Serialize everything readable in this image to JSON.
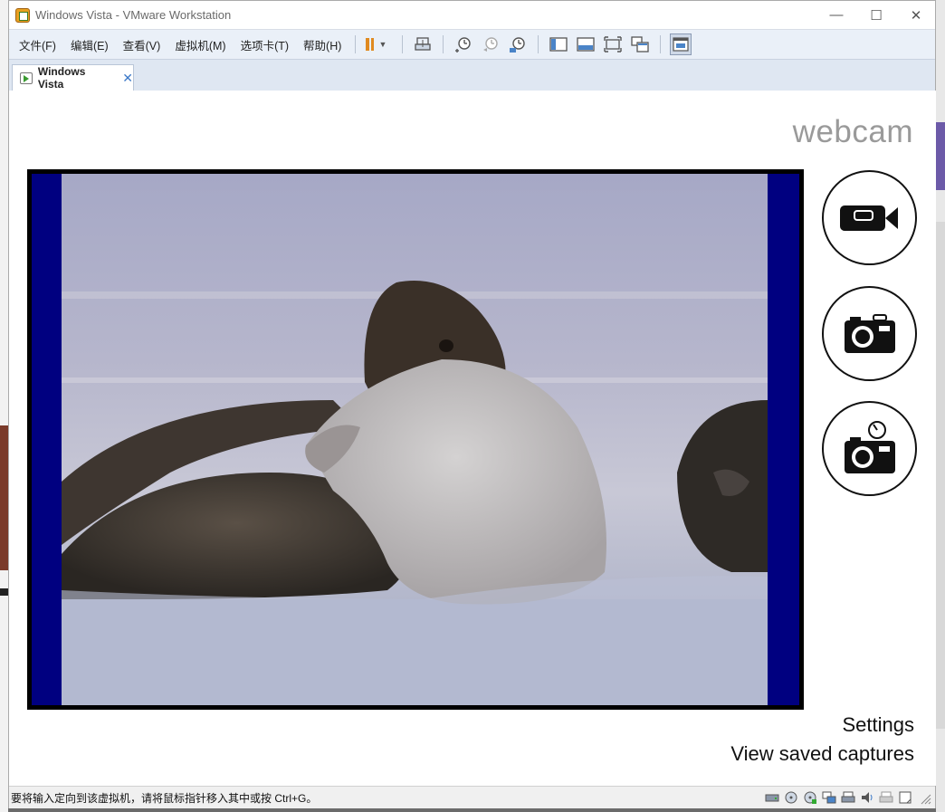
{
  "window": {
    "title": "Windows Vista - VMware Workstation",
    "controls": {
      "minimize": "—",
      "maximize": "☐",
      "close": "✕"
    }
  },
  "menu": {
    "items": [
      "文件(F)",
      "编辑(E)",
      "查看(V)",
      "虚拟机(M)",
      "选项卡(T)",
      "帮助(H)"
    ]
  },
  "toolbar": {
    "icons": [
      "pause-icon",
      "send-keys-icon",
      "snapshot-icon",
      "revert-snapshot-icon",
      "snapshot-manager-icon",
      "library-icon",
      "console-view-icon",
      "fullscreen-icon",
      "unity-icon",
      "thumbnail-icon"
    ]
  },
  "tab": {
    "label": "Windows Vista",
    "close": "✕"
  },
  "guest": {
    "title": "webcam",
    "links": {
      "settings": "Settings",
      "view_captures": "View saved captures"
    },
    "buttons": [
      "video-camera-icon",
      "camera-icon",
      "timer-camera-icon"
    ]
  },
  "status": {
    "message": "要将输入定向到该虚拟机，请将鼠标指针移入其中或按 Ctrl+G。"
  },
  "colors": {
    "frame_fill": "#000080",
    "menubar_bg": "#eaf0f8",
    "tabstrip_bg": "#dfe7f2"
  }
}
